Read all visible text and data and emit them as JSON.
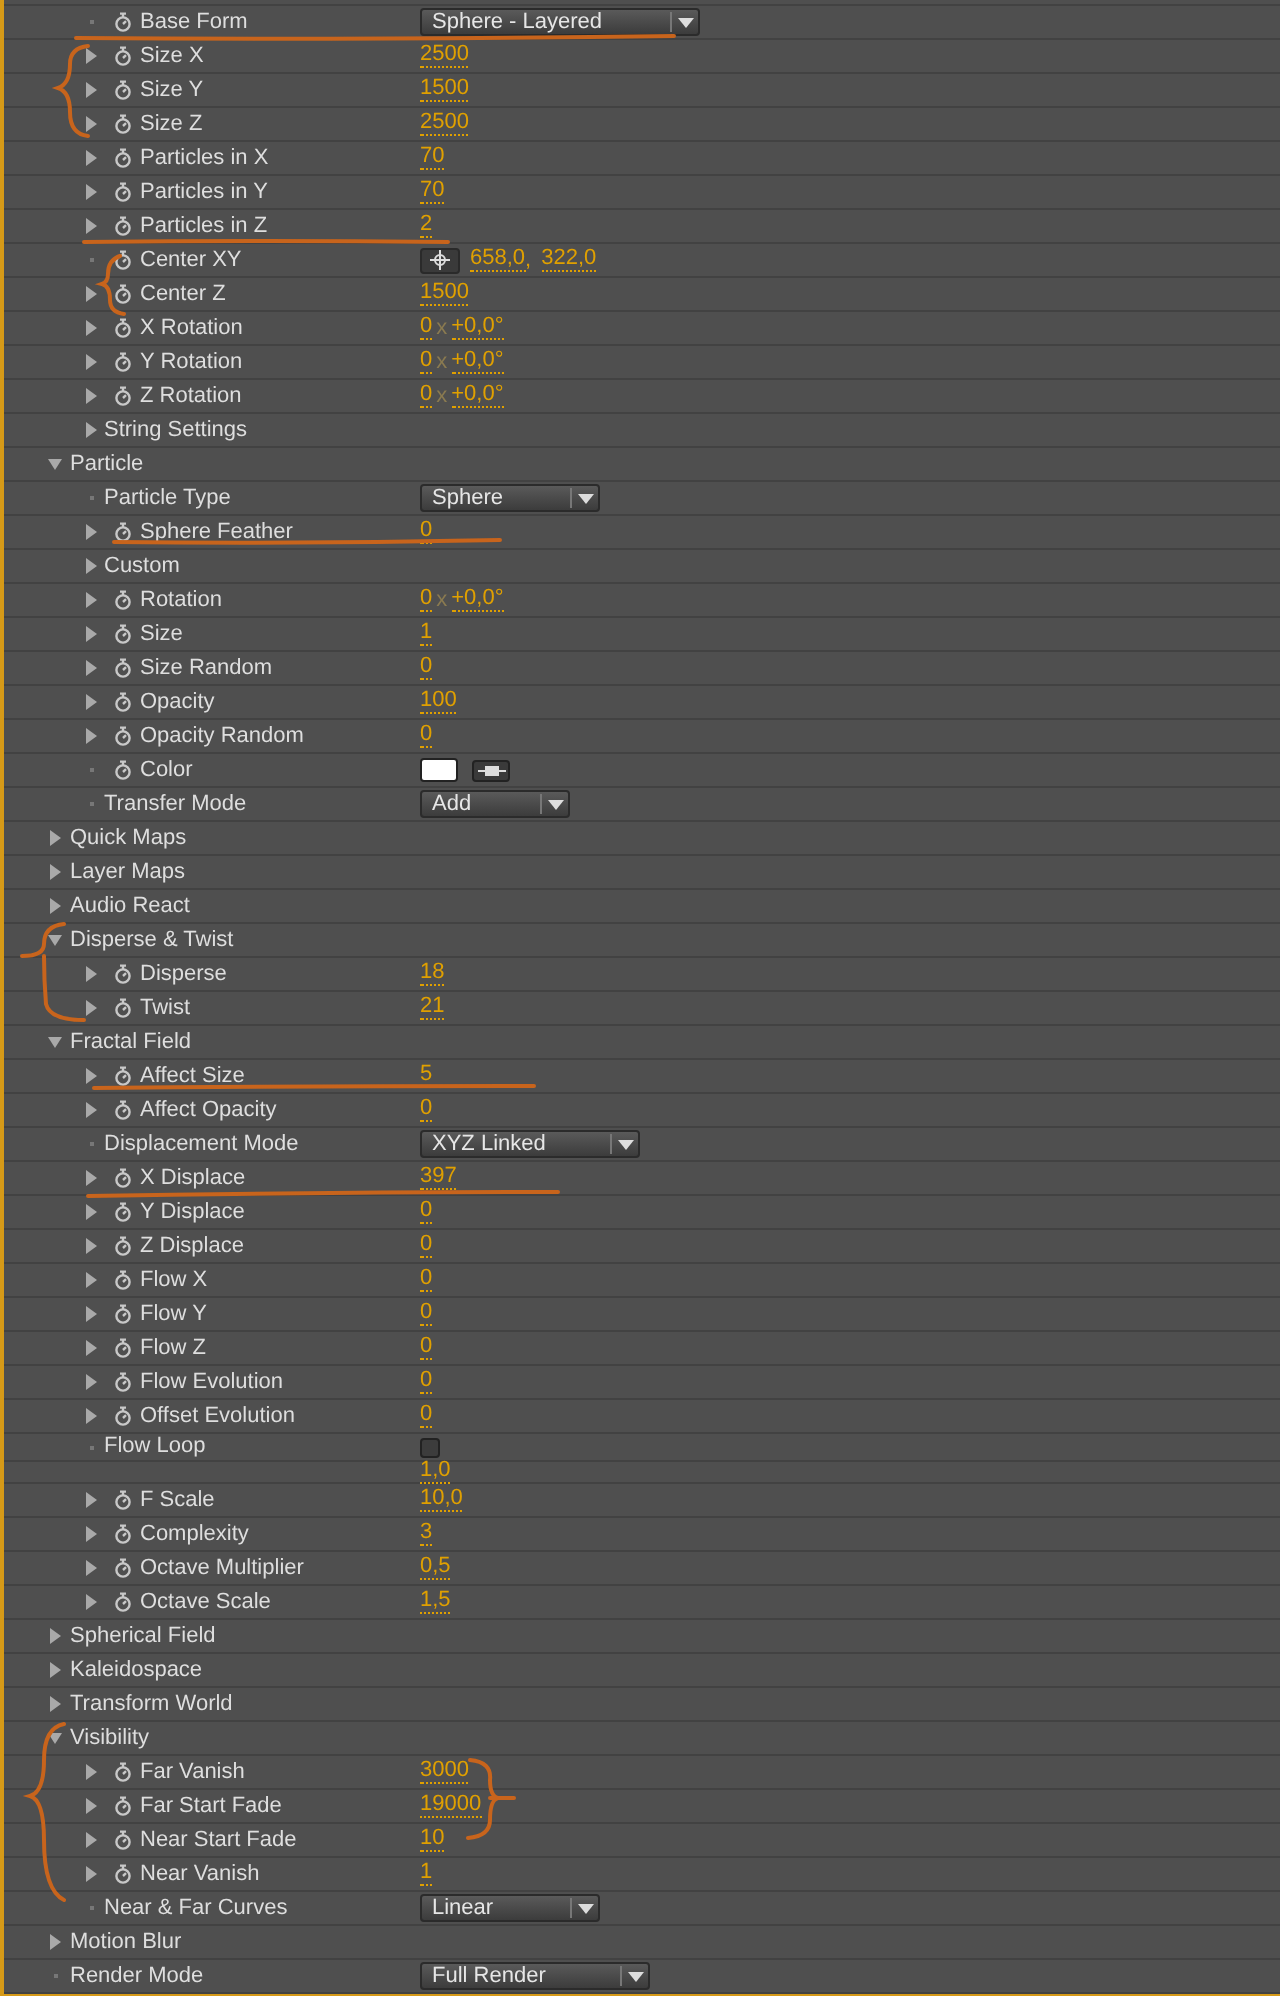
{
  "base_form_rows": [
    {
      "kind": "fixed",
      "label": "Base Form",
      "control": {
        "kind": "dropdown",
        "value": "Sphere - Layered"
      }
    },
    {
      "kind": "param",
      "label": "Size X",
      "expanded": false,
      "control": {
        "kind": "number",
        "value": "2500"
      }
    },
    {
      "kind": "param",
      "label": "Size Y",
      "expanded": false,
      "control": {
        "kind": "number",
        "value": "1500"
      }
    },
    {
      "kind": "param",
      "label": "Size Z",
      "expanded": false,
      "control": {
        "kind": "number",
        "value": "2500"
      }
    },
    {
      "kind": "param",
      "label": "Particles in X",
      "expanded": false,
      "control": {
        "kind": "number",
        "value": "70"
      }
    },
    {
      "kind": "param",
      "label": "Particles in Y",
      "expanded": false,
      "control": {
        "kind": "number",
        "value": "70"
      }
    },
    {
      "kind": "param",
      "label": "Particles in Z",
      "expanded": false,
      "control": {
        "kind": "number",
        "value": "2"
      }
    },
    {
      "kind": "fixed",
      "label": "Center XY",
      "control": {
        "kind": "point",
        "values": [
          "658,0",
          "322,0"
        ],
        "separator": ","
      }
    },
    {
      "kind": "param",
      "label": "Center Z",
      "expanded": false,
      "control": {
        "kind": "number",
        "value": "1500"
      }
    },
    {
      "kind": "param",
      "label": "X Rotation",
      "expanded": false,
      "control": {
        "kind": "rotation",
        "turns": "0",
        "separator": "x",
        "degrees": "+0,0°"
      }
    },
    {
      "kind": "param",
      "label": "Y Rotation",
      "expanded": false,
      "control": {
        "kind": "rotation",
        "turns": "0",
        "separator": "x",
        "degrees": "+0,0°"
      }
    },
    {
      "kind": "param",
      "label": "Z Rotation",
      "expanded": false,
      "control": {
        "kind": "rotation",
        "turns": "0",
        "separator": "x",
        "degrees": "+0,0°"
      }
    },
    {
      "kind": "folder",
      "label": "String Settings",
      "expanded": false
    }
  ],
  "sections": [
    {
      "kind": "section",
      "label": "Particle",
      "expanded": true,
      "children": [
        {
          "kind": "option",
          "label": "Particle Type",
          "control": {
            "kind": "dropdown",
            "value": "Sphere"
          }
        },
        {
          "kind": "param",
          "label": "Sphere Feather",
          "expanded": false,
          "control": {
            "kind": "number",
            "value": "0"
          }
        },
        {
          "kind": "folder",
          "label": "Custom",
          "expanded": false
        },
        {
          "kind": "param",
          "label": "Rotation",
          "expanded": false,
          "control": {
            "kind": "rotation",
            "turns": "0",
            "separator": "x",
            "degrees": "+0,0°"
          }
        },
        {
          "kind": "param",
          "label": "Size",
          "expanded": false,
          "control": {
            "kind": "number",
            "value": "1"
          }
        },
        {
          "kind": "param",
          "label": "Size Random",
          "expanded": false,
          "control": {
            "kind": "number",
            "value": "0"
          }
        },
        {
          "kind": "param",
          "label": "Opacity",
          "expanded": false,
          "control": {
            "kind": "number",
            "value": "100"
          }
        },
        {
          "kind": "param",
          "label": "Opacity Random",
          "expanded": false,
          "control": {
            "kind": "number",
            "value": "0"
          }
        },
        {
          "kind": "fixed",
          "label": "Color",
          "control": {
            "kind": "color",
            "color": "#ffffff"
          }
        },
        {
          "kind": "option",
          "label": "Transfer Mode",
          "control": {
            "kind": "dropdown",
            "value": "Add"
          }
        }
      ]
    },
    {
      "kind": "section",
      "label": "Quick Maps",
      "expanded": false
    },
    {
      "kind": "section",
      "label": "Layer Maps",
      "expanded": false
    },
    {
      "kind": "section",
      "label": "Audio React",
      "expanded": false
    },
    {
      "kind": "section",
      "label": "Disperse & Twist",
      "expanded": true,
      "children": [
        {
          "kind": "param",
          "label": "Disperse",
          "expanded": false,
          "control": {
            "kind": "number",
            "value": "18"
          }
        },
        {
          "kind": "param",
          "label": "Twist",
          "expanded": false,
          "control": {
            "kind": "number",
            "value": "21"
          }
        }
      ]
    },
    {
      "kind": "section",
      "label": "Fractal Field",
      "expanded": true,
      "children": [
        {
          "kind": "param",
          "label": "Affect Size",
          "expanded": false,
          "control": {
            "kind": "number",
            "value": "5"
          }
        },
        {
          "kind": "param",
          "label": "Affect Opacity",
          "expanded": false,
          "control": {
            "kind": "number",
            "value": "0"
          }
        },
        {
          "kind": "option",
          "label": "Displacement Mode",
          "control": {
            "kind": "dropdown",
            "value": "XYZ Linked"
          }
        },
        {
          "kind": "param",
          "label": "X Displace",
          "expanded": false,
          "control": {
            "kind": "number",
            "value": "397"
          }
        },
        {
          "kind": "param",
          "label": "Y Displace",
          "expanded": false,
          "control": {
            "kind": "number",
            "value": "0"
          }
        },
        {
          "kind": "param",
          "label": "Z Displace",
          "expanded": false,
          "control": {
            "kind": "number",
            "value": "0"
          }
        },
        {
          "kind": "param",
          "label": "Flow X",
          "expanded": false,
          "control": {
            "kind": "number",
            "value": "0"
          }
        },
        {
          "kind": "param",
          "label": "Flow Y",
          "expanded": false,
          "control": {
            "kind": "number",
            "value": "0"
          }
        },
        {
          "kind": "param",
          "label": "Flow Z",
          "expanded": false,
          "control": {
            "kind": "number",
            "value": "0"
          }
        },
        {
          "kind": "param",
          "label": "Flow Evolution",
          "expanded": false,
          "control": {
            "kind": "number",
            "value": "0"
          }
        },
        {
          "kind": "param",
          "label": "Offset Evolution",
          "expanded": false,
          "control": {
            "kind": "number",
            "value": "0"
          }
        },
        {
          "kind": "option",
          "label": "Flow Loop",
          "control": {
            "kind": "checkbox",
            "checked": false
          }
        },
        {
          "kind": "partial",
          "control": {
            "kind": "number",
            "value": "1,0"
          }
        },
        {
          "kind": "param",
          "label": "F Scale",
          "expanded": false,
          "control": {
            "kind": "number",
            "value": "10,0"
          }
        },
        {
          "kind": "param",
          "label": "Complexity",
          "expanded": false,
          "control": {
            "kind": "number",
            "value": "3"
          }
        },
        {
          "kind": "param",
          "label": "Octave Multiplier",
          "expanded": false,
          "control": {
            "kind": "number",
            "value": "0,5"
          }
        },
        {
          "kind": "param",
          "label": "Octave Scale",
          "expanded": false,
          "control": {
            "kind": "number",
            "value": "1,5"
          }
        }
      ]
    },
    {
      "kind": "section",
      "label": "Spherical Field",
      "expanded": false
    },
    {
      "kind": "section",
      "label": "Kaleidospace",
      "expanded": false
    },
    {
      "kind": "section",
      "label": "Transform World",
      "expanded": false
    },
    {
      "kind": "section",
      "label": "Visibility",
      "expanded": true,
      "children": [
        {
          "kind": "param",
          "label": "Far Vanish",
          "expanded": false,
          "control": {
            "kind": "number",
            "value": "3000"
          }
        },
        {
          "kind": "param",
          "label": "Far Start Fade",
          "expanded": false,
          "control": {
            "kind": "number",
            "value": "19000"
          }
        },
        {
          "kind": "param",
          "label": "Near Start Fade",
          "expanded": false,
          "control": {
            "kind": "number",
            "value": "10"
          }
        },
        {
          "kind": "param",
          "label": "Near Vanish",
          "expanded": false,
          "control": {
            "kind": "number",
            "value": "1"
          }
        },
        {
          "kind": "option",
          "label": "Near & Far Curves",
          "control": {
            "kind": "dropdown",
            "value": "Linear"
          }
        }
      ]
    },
    {
      "kind": "section",
      "label": "Motion Blur",
      "expanded": false
    },
    {
      "kind": "option",
      "label": "Render Mode",
      "control": {
        "kind": "dropdown",
        "value": "Full Render"
      }
    }
  ]
}
